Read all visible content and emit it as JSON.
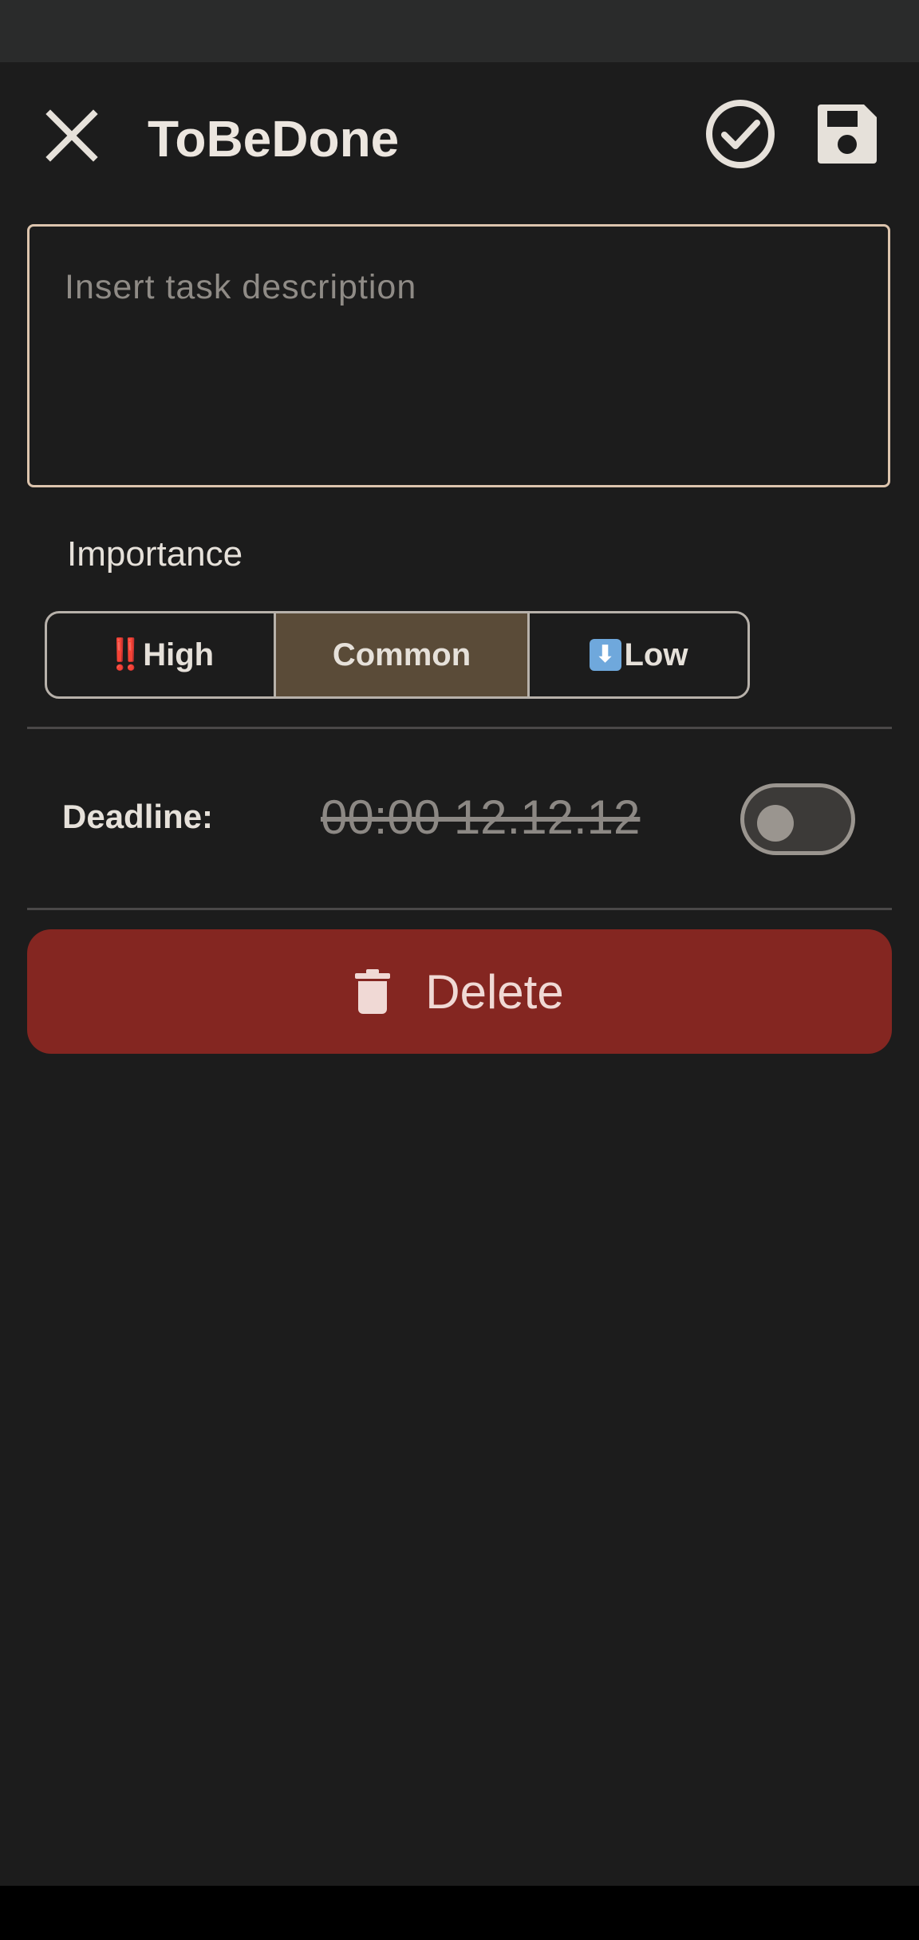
{
  "app": {
    "title": "ToBeDone"
  },
  "icons": {
    "close": "close-icon",
    "done": "check-circle-icon",
    "save": "floppy-disk-icon",
    "delete": "trash-icon"
  },
  "description": {
    "placeholder": "Insert task description",
    "value": ""
  },
  "importance": {
    "label": "Importance",
    "options": [
      {
        "emoji": "‼️",
        "label": "High",
        "selected": false
      },
      {
        "emoji": "⬇️",
        "label": "Low",
        "selected": false
      },
      {
        "emoji": "",
        "label": "Common",
        "selected": true
      }
    ]
  },
  "deadline": {
    "label": "Deadline:",
    "value": "00:00 12.12.12",
    "enabled": false
  },
  "actions": {
    "delete_label": "Delete"
  },
  "colors": {
    "background": "#1c1c1c",
    "accent_border": "#dcc4ad",
    "selected_segment": "#5a4b38",
    "delete": "#842621"
  }
}
